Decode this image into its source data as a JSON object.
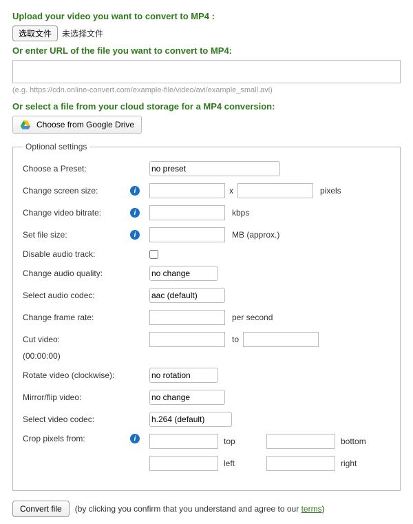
{
  "upload": {
    "heading": "Upload your video you want to convert to MP4 :",
    "choose_file_label": "选取文件",
    "no_file_label": "未选择文件"
  },
  "url": {
    "heading": "Or enter URL of the file you want to convert to MP4:",
    "value": "",
    "hint": "(e.g. https://cdn.online-convert.com/example-file/video/avi/example_small.avi)"
  },
  "cloud": {
    "heading": "Or select a file from your cloud storage for a MP4 conversion:",
    "gdrive_label": "Choose from Google Drive"
  },
  "optional": {
    "legend": "Optional settings",
    "preset": {
      "label": "Choose a Preset:",
      "value": "no preset"
    },
    "screen_size": {
      "label": "Change screen size:",
      "w": "",
      "h": "",
      "unit": "pixels",
      "sep": "x"
    },
    "bitrate": {
      "label": "Change video bitrate:",
      "value": "",
      "unit": "kbps"
    },
    "filesize": {
      "label": "Set file size:",
      "value": "",
      "unit": "MB (approx.)"
    },
    "disable_audio": {
      "label": "Disable audio track:",
      "checked": false
    },
    "audio_quality": {
      "label": "Change audio quality:",
      "value": "no change"
    },
    "audio_codec": {
      "label": "Select audio codec:",
      "value": "aac (default)"
    },
    "frame_rate": {
      "label": "Change frame rate:",
      "value": "",
      "unit": "per second"
    },
    "cut": {
      "label": "Cut video:",
      "from": "",
      "to": "",
      "sep": "to",
      "note": "(00:00:00)"
    },
    "rotate": {
      "label": "Rotate video (clockwise):",
      "value": "no rotation"
    },
    "mirror": {
      "label": "Mirror/flip video:",
      "value": "no change"
    },
    "video_codec": {
      "label": "Select video codec:",
      "value": "h.264 (default)"
    },
    "crop": {
      "label": "Crop pixels from:",
      "top": "",
      "bottom": "",
      "left": "",
      "right": "",
      "top_label": "top",
      "bottom_label": "bottom",
      "left_label": "left",
      "right_label": "right"
    }
  },
  "convert": {
    "button_label": "Convert file",
    "disclaimer_prefix": "(by clicking you confirm that you understand and agree to our ",
    "terms_label": "terms",
    "disclaimer_suffix": ")"
  },
  "info_glyph": "i"
}
